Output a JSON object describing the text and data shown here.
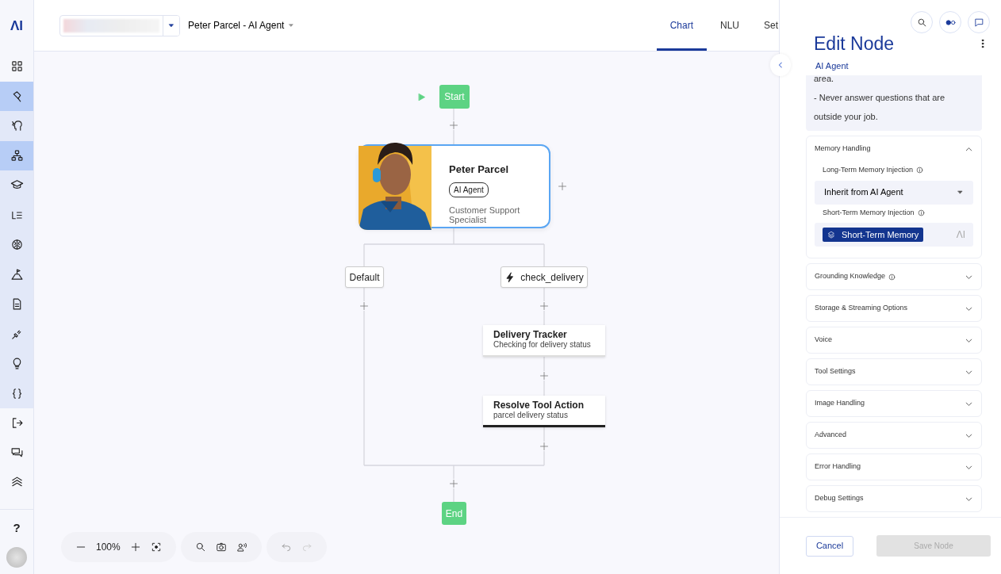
{
  "logo": "ΛI",
  "sidebar": {
    "items": [
      {
        "selected": false,
        "grouped": false
      },
      {
        "selected": true,
        "grouped": true
      },
      {
        "selected": false,
        "grouped": true
      },
      {
        "selected": true,
        "grouped": true
      },
      {
        "selected": false,
        "grouped": true
      },
      {
        "selected": false,
        "grouped": true
      },
      {
        "selected": false,
        "grouped": true
      },
      {
        "selected": false,
        "grouped": true
      },
      {
        "selected": false,
        "grouped": true
      },
      {
        "selected": false,
        "grouped": true
      },
      {
        "selected": false,
        "grouped": true
      },
      {
        "selected": false,
        "grouped": true
      },
      {
        "selected": false,
        "grouped": false
      },
      {
        "selected": false,
        "grouped": false
      },
      {
        "selected": false,
        "grouped": false
      }
    ],
    "help": "?"
  },
  "header": {
    "flow_title": "Peter Parcel - AI Agent",
    "tabs": [
      {
        "label": "Chart",
        "selected": true
      },
      {
        "label": "NLU",
        "selected": false
      },
      {
        "label": "Set",
        "selected": false
      }
    ]
  },
  "flow": {
    "start": "Start",
    "end": "End",
    "agent": {
      "name": "Peter Parcel",
      "badge": "AI Agent",
      "role": "Customer Support Specialist",
      "kind": "picture"
    },
    "branches": [
      {
        "label": "Default",
        "kind": "plain"
      },
      {
        "label": "check_delivery",
        "kind": "tool"
      }
    ],
    "nodes": [
      {
        "title": "Delivery Tracker",
        "subtitle": "Checking for delivery status",
        "selected": false
      },
      {
        "title": "Resolve Tool Action",
        "subtitle": "parcel delivery status",
        "selected": true
      }
    ]
  },
  "toolbar": {
    "zoom": "100%"
  },
  "panel": {
    "title": "Edit Node",
    "subtitle": "AI Agent",
    "instructions": [
      "area.",
      "- Never answer questions that are outside your job."
    ],
    "sections": [
      {
        "title": "Memory Handling",
        "expanded": true,
        "info": false,
        "fields": [
          {
            "label": "Long-Term Memory Injection",
            "kind": "select",
            "value": "Inherit from AI Agent"
          },
          {
            "label": "Short-Term Memory Injection",
            "kind": "token",
            "value": "Short-Term Memory",
            "logo": "ΛI"
          }
        ]
      },
      {
        "title": "Grounding Knowledge",
        "expanded": false,
        "info": true
      },
      {
        "title": "Storage & Streaming Options",
        "expanded": false,
        "info": false
      },
      {
        "title": "Voice",
        "expanded": false,
        "info": false
      },
      {
        "title": "Tool Settings",
        "expanded": false,
        "info": false
      },
      {
        "title": "Image Handling",
        "expanded": false,
        "info": false
      },
      {
        "title": "Advanced",
        "expanded": false,
        "info": false
      },
      {
        "title": "Error Handling",
        "expanded": false,
        "info": false
      },
      {
        "title": "Debug Settings",
        "expanded": false,
        "info": false
      }
    ],
    "cancel": "Cancel",
    "save": {
      "label": "Save Node",
      "disabled": true
    }
  }
}
